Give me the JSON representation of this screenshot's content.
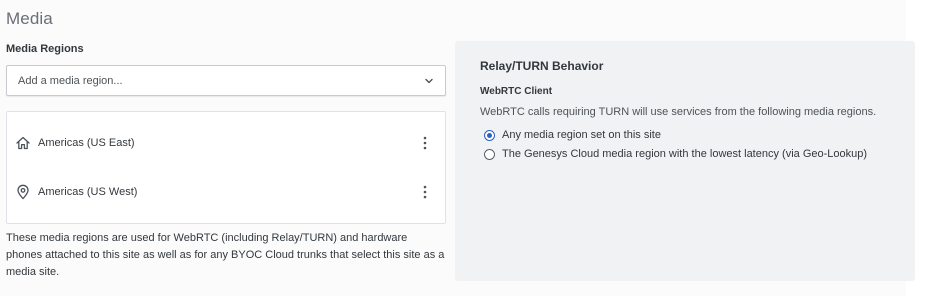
{
  "page": {
    "title": "Media"
  },
  "media_regions": {
    "section_label": "Media Regions",
    "dropdown_placeholder": "Add a media region...",
    "regions": [
      {
        "label": "Americas (US East)",
        "icon": "home-icon"
      },
      {
        "label": "Americas (US West)",
        "icon": "location-pin-icon"
      }
    ],
    "help_text": "These media regions are used for WebRTC (including Relay/TURN) and hardware phones attached to this site as well as for any BYOC Cloud trunks that select this site as a media site."
  },
  "relay": {
    "title": "Relay/TURN Behavior",
    "subtitle": "WebRTC Client",
    "description": "WebRTC calls requiring TURN will use services from the following media regions.",
    "options": [
      {
        "label": "Any media region set on this site",
        "checked": true
      },
      {
        "label": "The Genesys Cloud media region with the lowest latency (via Geo-Lookup)",
        "checked": false
      }
    ]
  },
  "colors": {
    "accent": "#2a60c8",
    "panel_bg": "#f1f2f4",
    "text": "#33383d"
  }
}
